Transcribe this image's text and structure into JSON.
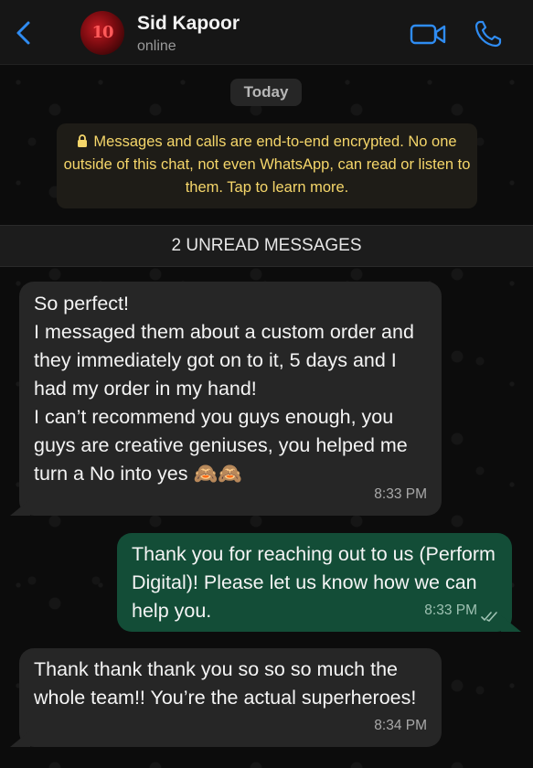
{
  "header": {
    "contact_name": "Sid Kapoor",
    "status": "online",
    "avatar_text": "10",
    "icons": {
      "back": "chevron-left-icon",
      "video": "video-camera-icon",
      "call": "phone-icon"
    },
    "accent_color": "#2f8cf2"
  },
  "chat": {
    "date_label": "Today",
    "encryption_notice": "Messages and calls are end-to-end encrypted. No one outside of this chat, not even WhatsApp, can read or listen to them. Tap to learn more.",
    "encryption_color": "#f5d66a",
    "unread_banner": "2 UNREAD MESSAGES",
    "messages": [
      {
        "direction": "incoming",
        "text": "So perfect!\nI messaged them about a custom order and they immediately got on to it, 5 days and I had my order in my hand!\nI can’t recommend you guys enough, you guys are creative geniuses, you helped me turn a No into yes 🙈🙈",
        "time": "8:33 PM"
      },
      {
        "direction": "outgoing",
        "text": "Thank you for reaching out to us (Perform Digital)! Please let us know how we can help you.",
        "time": "8:33 PM",
        "status": "read"
      },
      {
        "direction": "incoming",
        "text": "Thank thank thank you so so so much the whole team!! You’re the actual superheroes!",
        "time": "8:34 PM"
      }
    ],
    "colors": {
      "incoming_bubble": "#262626",
      "outgoing_bubble": "#134d37"
    }
  }
}
